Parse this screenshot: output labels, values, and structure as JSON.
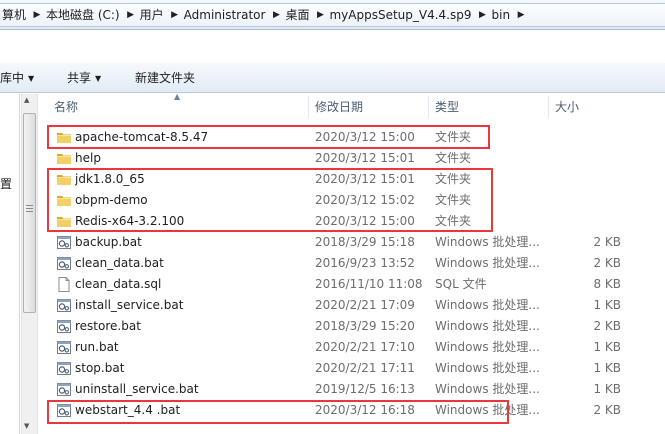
{
  "breadcrumb": {
    "items": [
      "算机",
      "本地磁盘 (C:)",
      "用户",
      "Administrator",
      "桌面",
      "myAppsSetup_V4.4.sp9",
      "bin"
    ]
  },
  "toolbar": {
    "library_label": "库中",
    "share_label": "共享",
    "new_folder_label": "新建文件夹"
  },
  "nav": {
    "partial_label": "置"
  },
  "columns": {
    "name": "名称",
    "modified": "修改日期",
    "type": "类型",
    "size": "大小"
  },
  "files": [
    {
      "name": "apache-tomcat-8.5.47",
      "modified": "2020/3/12 15:00",
      "type": "文件夹",
      "size": "",
      "icon": "folder-icon"
    },
    {
      "name": "help",
      "modified": "2020/3/12 15:01",
      "type": "文件夹",
      "size": "",
      "icon": "folder-icon"
    },
    {
      "name": "jdk1.8.0_65",
      "modified": "2020/3/12 15:01",
      "type": "文件夹",
      "size": "",
      "icon": "folder-icon"
    },
    {
      "name": "obpm-demo",
      "modified": "2020/3/12 15:02",
      "type": "文件夹",
      "size": "",
      "icon": "folder-icon"
    },
    {
      "name": "Redis-x64-3.2.100",
      "modified": "2020/3/12 15:00",
      "type": "文件夹",
      "size": "",
      "icon": "folder-icon"
    },
    {
      "name": "backup.bat",
      "modified": "2018/3/29 15:18",
      "type": "Windows 批处理...",
      "size": "2 KB",
      "icon": "batch-file-icon"
    },
    {
      "name": "clean_data.bat",
      "modified": "2016/9/23 13:52",
      "type": "Windows 批处理...",
      "size": "2 KB",
      "icon": "batch-file-icon"
    },
    {
      "name": "clean_data.sql",
      "modified": "2016/11/10 11:08",
      "type": "SQL 文件",
      "size": "8 KB",
      "icon": "text-file-icon"
    },
    {
      "name": "install_service.bat",
      "modified": "2020/2/21 17:09",
      "type": "Windows 批处理...",
      "size": "1 KB",
      "icon": "batch-file-icon"
    },
    {
      "name": "restore.bat",
      "modified": "2018/3/29 15:20",
      "type": "Windows 批处理...",
      "size": "2 KB",
      "icon": "batch-file-icon"
    },
    {
      "name": "run.bat",
      "modified": "2020/2/21 17:10",
      "type": "Windows 批处理...",
      "size": "1 KB",
      "icon": "batch-file-icon"
    },
    {
      "name": "stop.bat",
      "modified": "2020/2/21 17:11",
      "type": "Windows 批处理...",
      "size": "1 KB",
      "icon": "batch-file-icon"
    },
    {
      "name": "uninstall_service.bat",
      "modified": "2019/12/5 16:13",
      "type": "Windows 批处理...",
      "size": "1 KB",
      "icon": "batch-file-icon"
    },
    {
      "name": "webstart_4.4 .bat",
      "modified": "2020/3/12 16:18",
      "type": "Windows 批处理...",
      "size": "2 KB",
      "icon": "batch-file-icon"
    }
  ],
  "colors": {
    "highlight_box": "#e8383b",
    "folder": "#e8c04a"
  }
}
